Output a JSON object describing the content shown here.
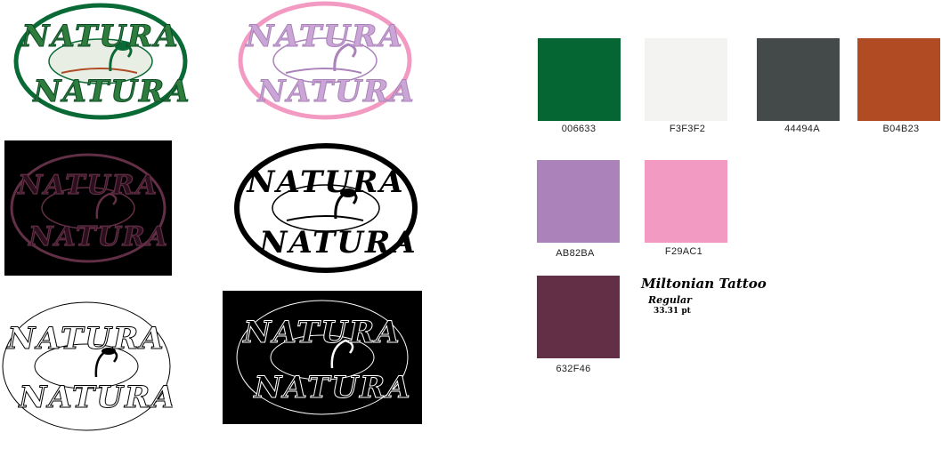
{
  "logos": {
    "wordmark_top": "NATURA",
    "wordmark_bottom": "NATURA"
  },
  "palette": [
    {
      "code": "006633",
      "hex": "#066633"
    },
    {
      "code": "F3F3F2",
      "hex": "#F3F3F2"
    },
    {
      "code": "44494A",
      "hex": "#44494A"
    },
    {
      "code": "B04B23",
      "hex": "#B04B23"
    },
    {
      "code": "AB82BA",
      "hex": "#AB82BA"
    },
    {
      "code": "F29AC1",
      "hex": "#F29AC1"
    },
    {
      "code": "632F46",
      "hex": "#632F46"
    }
  ],
  "typography": {
    "font_name": "Miltonian Tattoo",
    "style": "Regular",
    "size": "33.31 pt"
  }
}
